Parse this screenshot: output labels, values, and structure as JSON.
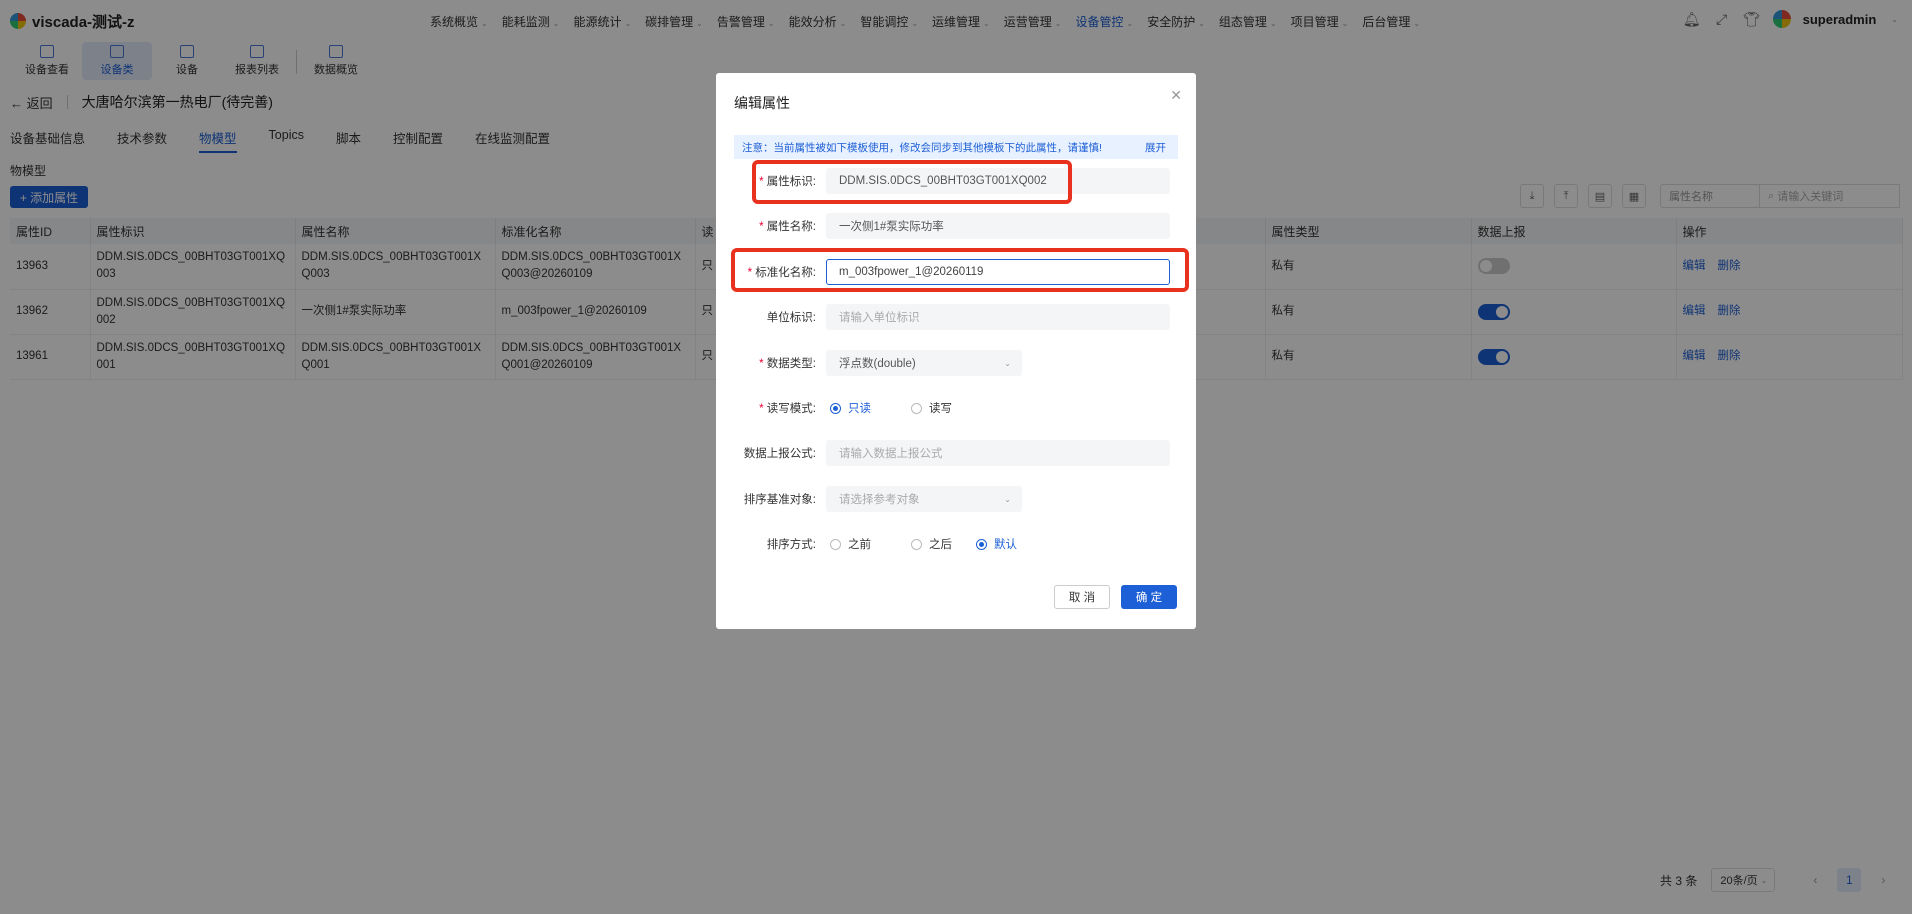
{
  "app": {
    "title": "viscada-测试-z",
    "user": "superadmin"
  },
  "nav": [
    {
      "label": "系统概览"
    },
    {
      "label": "能耗监测"
    },
    {
      "label": "能源统计"
    },
    {
      "label": "碳排管理"
    },
    {
      "label": "告警管理"
    },
    {
      "label": "能效分析"
    },
    {
      "label": "智能调控"
    },
    {
      "label": "运维管理"
    },
    {
      "label": "运营管理"
    },
    {
      "label": "设备管控"
    },
    {
      "label": "安全防护"
    },
    {
      "label": "组态管理"
    },
    {
      "label": "项目管理"
    },
    {
      "label": "后台管理"
    }
  ],
  "toolbar": [
    {
      "label": "设备查看"
    },
    {
      "label": "设备类"
    },
    {
      "label": "设备"
    },
    {
      "label": "报表列表"
    },
    {
      "label": "数据概览"
    }
  ],
  "page": {
    "back": "返回",
    "title": "大唐哈尔滨第一热电厂(待完善)"
  },
  "tabs": [
    {
      "label": "设备基础信息"
    },
    {
      "label": "技术参数"
    },
    {
      "label": "物模型"
    },
    {
      "label": "Topics"
    },
    {
      "label": "脚本"
    },
    {
      "label": "控制配置"
    },
    {
      "label": "在线监测配置"
    }
  ],
  "section": {
    "label": "物模型",
    "add_button": "+ 添加属性"
  },
  "filter": {
    "field": "属性名称",
    "search_placeholder": "请输入关键词"
  },
  "table": {
    "headers": [
      "属性ID",
      "属性标识",
      "属性名称",
      "标准化名称",
      "读",
      "",
      "",
      "",
      "",
      "属性类型",
      "数据上报",
      "操作"
    ],
    "rows": [
      {
        "id": "13963",
        "ident": "DDM.SIS.0DCS_00BHT03GT001XQ003",
        "name": "DDM.SIS.0DCS_00BHT03GT001XQ003",
        "std": "DDM.SIS.0DCS_00BHT03GT001XQ003@20260109",
        "rw": "只",
        "type": "私有",
        "report": false,
        "edit": "编辑",
        "del": "删除"
      },
      {
        "id": "13962",
        "ident": "DDM.SIS.0DCS_00BHT03GT001XQ002",
        "name": "一次侧1#泵实际功率",
        "std": "m_003fpower_1@20260109",
        "rw": "只",
        "type": "私有",
        "report": true,
        "edit": "编辑",
        "del": "删除"
      },
      {
        "id": "13961",
        "ident": "DDM.SIS.0DCS_00BHT03GT001XQ001",
        "name": "DDM.SIS.0DCS_00BHT03GT001XQ001",
        "std": "DDM.SIS.0DCS_00BHT03GT001XQ001@20260109",
        "rw": "只",
        "type": "私有",
        "report": true,
        "edit": "编辑",
        "del": "删除"
      }
    ]
  },
  "pagination": {
    "total": "共 3 条",
    "page_size": "20条/页",
    "current": "1"
  },
  "modal": {
    "title": "编辑属性",
    "notice": "注意：当前属性被如下模板使用，修改会同步到其他模板下的此属性，请谨慎!",
    "notice_expand": "展开",
    "fields": {
      "ident": {
        "label": "属性标识:",
        "value": "DDM.SIS.0DCS_00BHT03GT001XQ002"
      },
      "name": {
        "label": "属性名称:",
        "value": "一次侧1#泵实际功率"
      },
      "std": {
        "label": "标准化名称:",
        "value": "m_003fpower_1@20260119"
      },
      "unit": {
        "label": "单位标识:",
        "placeholder": "请输入单位标识"
      },
      "dtype": {
        "label": "数据类型:",
        "value": "浮点数(double)"
      },
      "rw": {
        "label": "读写模式:",
        "options": [
          "只读",
          "读写"
        ],
        "selected": "只读"
      },
      "formula": {
        "label": "数据上报公式:",
        "placeholder": "请输入数据上报公式"
      },
      "ref": {
        "label": "排序基准对象:",
        "placeholder": "请选择参考对象"
      },
      "order": {
        "label": "排序方式:",
        "options": [
          "之前",
          "之后",
          "默认"
        ],
        "selected": "默认"
      }
    },
    "cancel": "取 消",
    "ok": "确 定"
  },
  "colors": {
    "primary": "#1d5fd6",
    "highlight": "#e8321f"
  }
}
